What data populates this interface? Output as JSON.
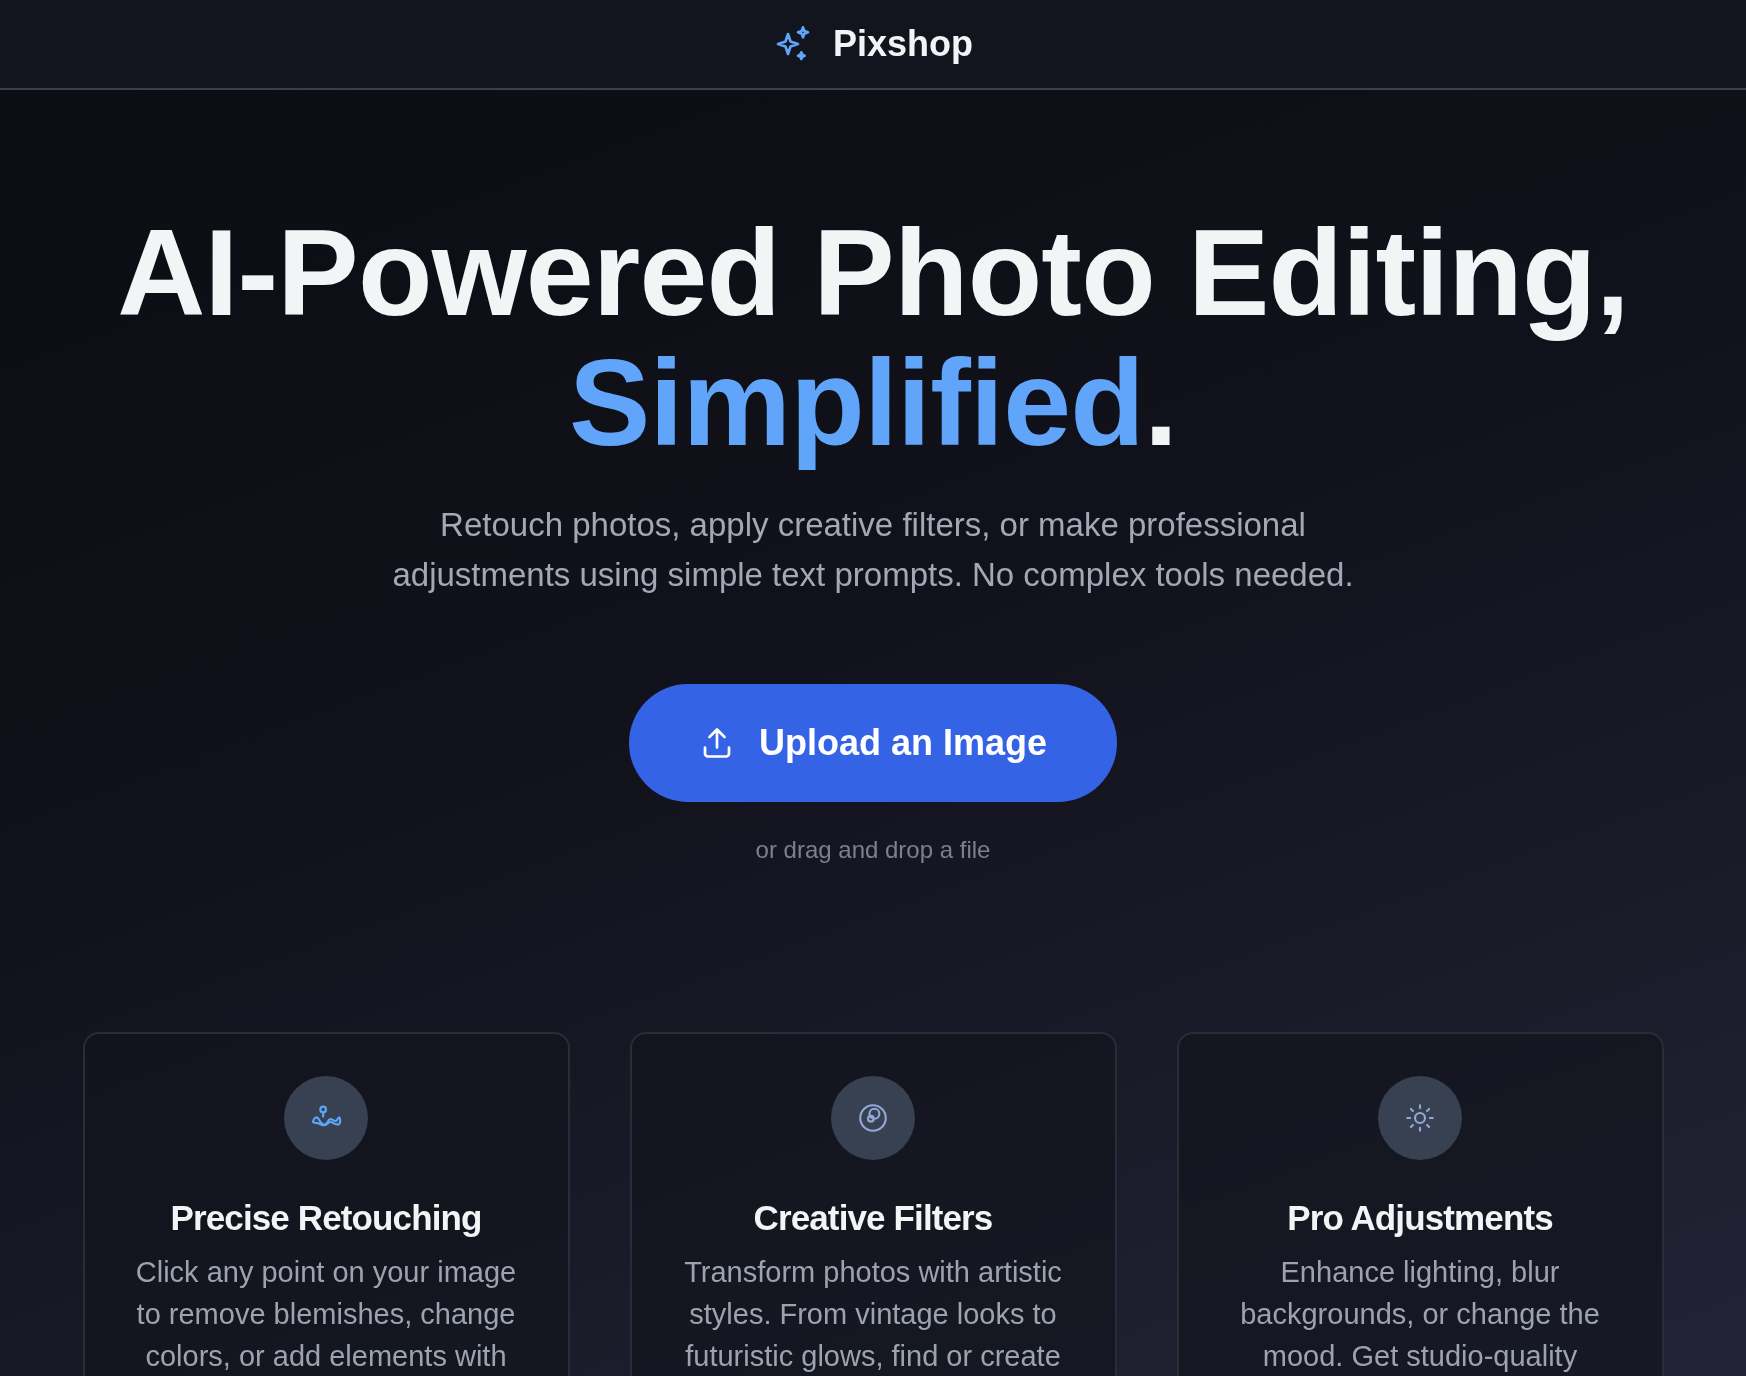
{
  "header": {
    "brand": "Pixshop"
  },
  "hero": {
    "headline": "AI-Powered Photo Editing,",
    "highlight": "Simplified",
    "period": ".",
    "subtitle_lines": [
      "Retouch photos, apply creative filters, or make professional",
      "adjustments using simple text prompts. No complex tools needed."
    ],
    "upload_button": "Upload an Image",
    "drop_hint": "or drag and drop a file"
  },
  "features": [
    {
      "kind": "retouch",
      "title": "Precise Retouching",
      "description_lines": [
        "Click any point on your image",
        "to remove blemishes, change",
        "colors, or add elements with"
      ]
    },
    {
      "kind": "filters",
      "title": "Creative Filters",
      "description_lines": [
        "Transform photos with artistic",
        "styles. From vintage looks to",
        "futuristic glows, find or create"
      ]
    },
    {
      "kind": "adjust",
      "title": "Pro Adjustments",
      "description_lines": [
        "Enhance lighting, blur",
        "backgrounds, or change the",
        "mood. Get studio-quality"
      ]
    }
  ]
}
